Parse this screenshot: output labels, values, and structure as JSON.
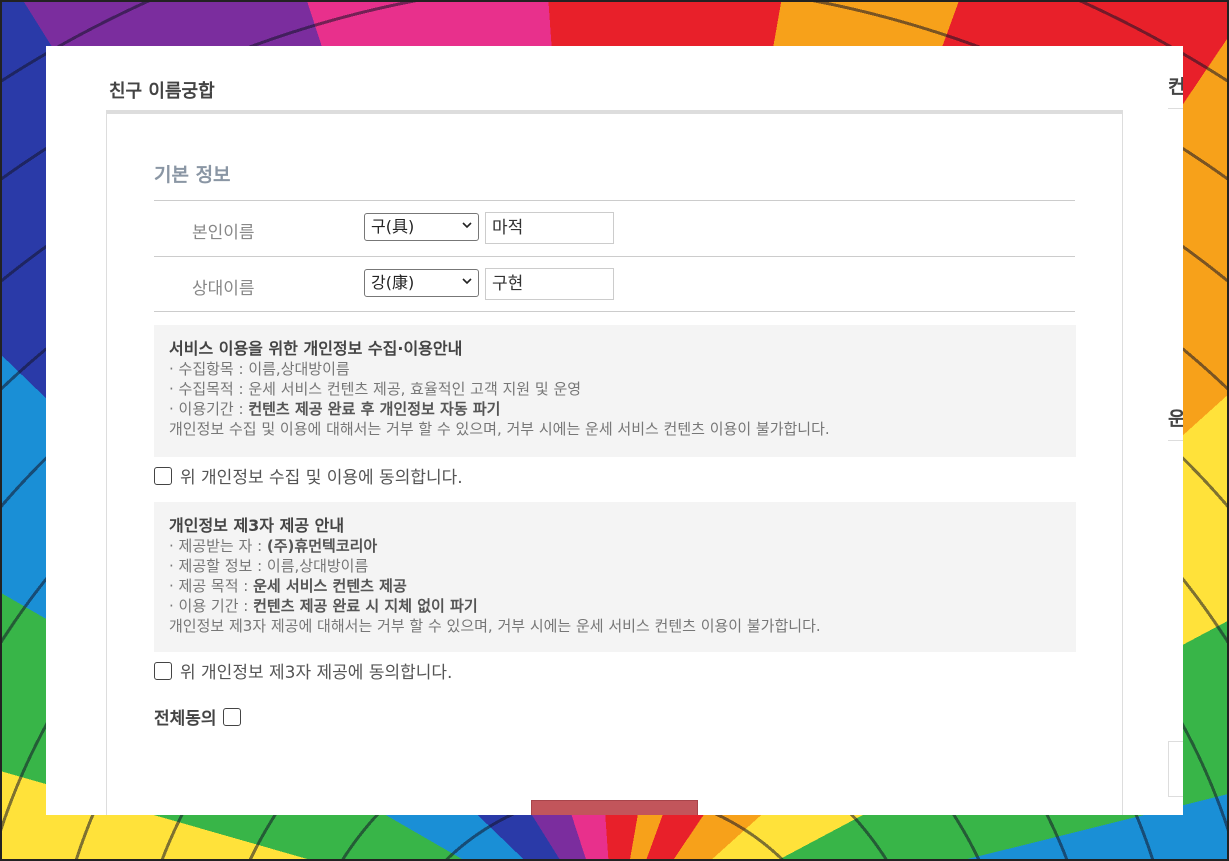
{
  "page": {
    "heading": "친구 이름궁합"
  },
  "side": {
    "text1": "컨",
    "text2": "운"
  },
  "basic_info": {
    "title": "기본 정보",
    "rows": [
      {
        "label": "본인이름",
        "surname": "구(具)",
        "name": "마적"
      },
      {
        "label": "상대이름",
        "surname": "강(康)",
        "name": "구현"
      }
    ]
  },
  "privacy_collect": {
    "title": "서비스 이용을 위한 개인정보 수집·이용안내",
    "line1_prefix": "· 수집항목 : ",
    "line1_value": "이름,상대방이름",
    "line2_prefix": "· 수집목적 : ",
    "line2_value": "운세 서비스 컨텐츠 제공, 효율적인 고객 지원 및 운영",
    "line3_prefix": "· 이용기간 : ",
    "line3_value": "컨텐츠 제공 완료 후 개인정보 자동 파기",
    "note": "개인정보 수집 및 이용에 대해서는 거부 할 수 있으며, 거부 시에는 운세 서비스 컨텐츠 이용이 불가합니다.",
    "agree_label": "위 개인정보 수집 및 이용에 동의합니다."
  },
  "privacy_third": {
    "title": "개인정보 제3자 제공 안내",
    "line1_prefix": "· 제공받는 자 : ",
    "line1_value": "(주)휴먼텍코리아",
    "line2_prefix": "· 제공할 정보 : ",
    "line2_value": "이름,상대방이름",
    "line3_prefix": "· 제공 목적 : ",
    "line3_value": "운세 서비스 컨텐츠 제공",
    "line4_prefix": "· 이용 기간 : ",
    "line4_value": "컨텐츠 제공 완료 시 지체 없이 파기",
    "note": "개인정보 제3자 제공에 대해서는 거부 할 수 있으며, 거부 시에는 운세 서비스 컨텐츠 이용이 불가합니다.",
    "agree_label": "위 개인정보 제3자 제공에 동의합니다."
  },
  "all_agree_label": "전체동의",
  "colors": {
    "submit": "#c2555b",
    "section_title": "#8a96a4"
  }
}
